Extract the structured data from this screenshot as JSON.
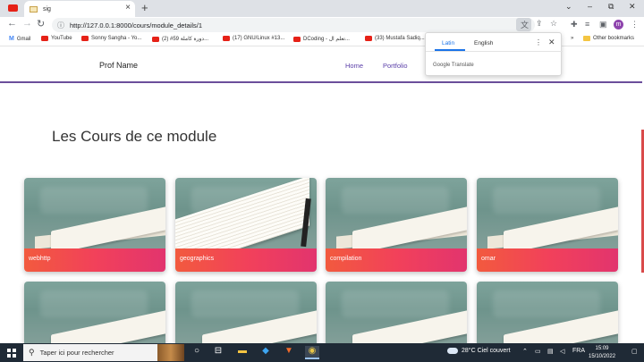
{
  "browser": {
    "tab": {
      "title": "sig",
      "close": "×"
    },
    "new_tab": "+",
    "window_controls": {
      "minimize": "⌄",
      "minimize2": "–",
      "restore": "⧉",
      "close": "✕"
    },
    "url": "http://127.0.0.1:8000/cours/module_details/1",
    "bookmarks": [
      {
        "label": "Gmail",
        "icon": "gmail-icon"
      },
      {
        "label": "YouTube",
        "icon": "youtube-icon"
      },
      {
        "label": "Sonny Sangha - Yo...",
        "icon": "youtube-icon"
      },
      {
        "label": "(2) #59 دورة كاملة...",
        "icon": "youtube-icon"
      },
      {
        "label": "(17) GNU/Linux #13...",
        "icon": "youtube-icon"
      },
      {
        "label": "DCoding - تعلم ال...",
        "icon": "youtube-icon"
      },
      {
        "label": "(33) Mustafa Sadiq...",
        "icon": "youtube-icon"
      }
    ],
    "bookmarks_overflow": "»",
    "other_bookmarks": "Other bookmarks",
    "profile_initial": "m"
  },
  "translate_popup": {
    "tab_source": "Latin",
    "tab_target": "English",
    "menu": "⋮",
    "close": "✕",
    "brand": "Google Translate"
  },
  "site": {
    "brand": "Prof Name",
    "nav": [
      "Home",
      "Portfolio"
    ],
    "heading": "Les Cours de ce module",
    "courses": [
      "webhttp",
      "geographics",
      "compilation",
      "omar"
    ]
  },
  "taskbar": {
    "search_placeholder": "Taper ici pour rechercher",
    "weather_temp": "28°C",
    "weather_text": "Ciel couvert",
    "lang": "FRA",
    "time": "15:09",
    "date": "15/10/2022"
  },
  "colors": {
    "accent": "#6b4e9b",
    "card_gradient_start": "#f25a3e",
    "card_gradient_end": "#e2346e"
  }
}
